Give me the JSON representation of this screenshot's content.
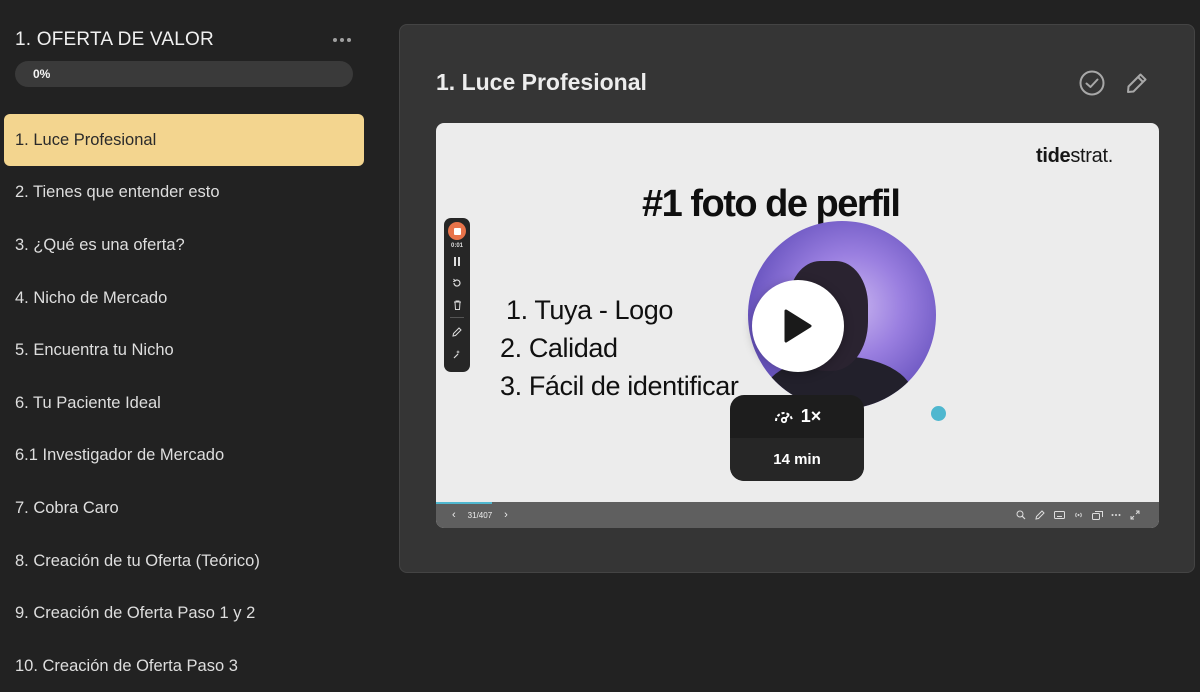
{
  "sidebar": {
    "module_title": "1. OFERTA DE VALOR",
    "progress_label": "0%",
    "progress_value": 0,
    "lessons": [
      {
        "label": "1. Luce Profesional",
        "active": true
      },
      {
        "label": "2. Tienes que entender esto"
      },
      {
        "label": "3. ¿Qué es una oferta?"
      },
      {
        "label": "4. Nicho de Mercado"
      },
      {
        "label": "5. Encuentra tu Nicho"
      },
      {
        "label": "6. Tu Paciente Ideal"
      },
      {
        "label": "6.1 Investigador de Mercado"
      },
      {
        "label": "7. Cobra Caro"
      },
      {
        "label": "8. Creación de tu Oferta (Teórico)"
      },
      {
        "label": "9. Creación de Oferta Paso 1 y 2"
      },
      {
        "label": "10. Creación de Oferta Paso 3"
      }
    ]
  },
  "main": {
    "lesson_title": "1. Luce Profesional",
    "icons": [
      "check-circle-icon",
      "pencil-icon"
    ]
  },
  "video": {
    "brand_bold": "tide",
    "brand_rest": "strat.",
    "slide_heading": "#1 foto de perfil",
    "slide_items": [
      "1. Tuya - Logo",
      "2. Calidad",
      "3. Fácil de identificar"
    ],
    "recorder_time": "0:01",
    "speed": "1×",
    "duration": "14 min",
    "page_indicator": "31/407",
    "accent_color": "#4fb7cf"
  },
  "colors": {
    "active_lesson": "#f3d58f",
    "background": "#222222",
    "panel": "#353535"
  }
}
